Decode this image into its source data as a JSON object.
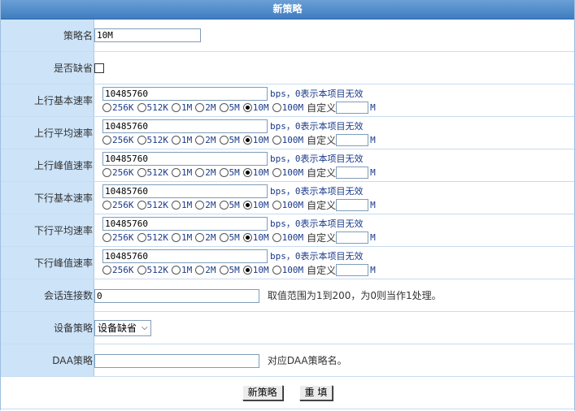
{
  "title": "新策略",
  "fields": {
    "name": {
      "label": "策略名",
      "value": "10M"
    },
    "default": {
      "label": "是否缺省",
      "checked": false
    },
    "rates": [
      {
        "label": "上行基本速率",
        "value": "10485760",
        "selected": "10M"
      },
      {
        "label": "上行平均速率",
        "value": "10485760",
        "selected": "10M"
      },
      {
        "label": "上行峰值速率",
        "value": "10485760",
        "selected": "10M"
      },
      {
        "label": "下行基本速率",
        "value": "10485760",
        "selected": "10M"
      },
      {
        "label": "下行平均速率",
        "value": "10485760",
        "selected": "10M"
      },
      {
        "label": "下行峰值速率",
        "value": "10485760",
        "selected": "10M"
      }
    ],
    "rate_unit_hint": "bps，0表示本项目无效",
    "rate_options": [
      "256K",
      "512K",
      "1M",
      "2M",
      "5M",
      "10M",
      "100M"
    ],
    "custom_label": "自定义",
    "custom_unit": "M",
    "sessions": {
      "label": "会话连接数",
      "value": "0",
      "hint": "取值范围为1到200，为0则当作1处理。"
    },
    "device_policy": {
      "label": "设备策略",
      "value": "设备缺省"
    },
    "daa_policy": {
      "label": "DAA策略",
      "value": "",
      "hint": "对应DAA策略名。"
    }
  },
  "buttons": {
    "submit": "新策略",
    "reset": "重 填"
  }
}
